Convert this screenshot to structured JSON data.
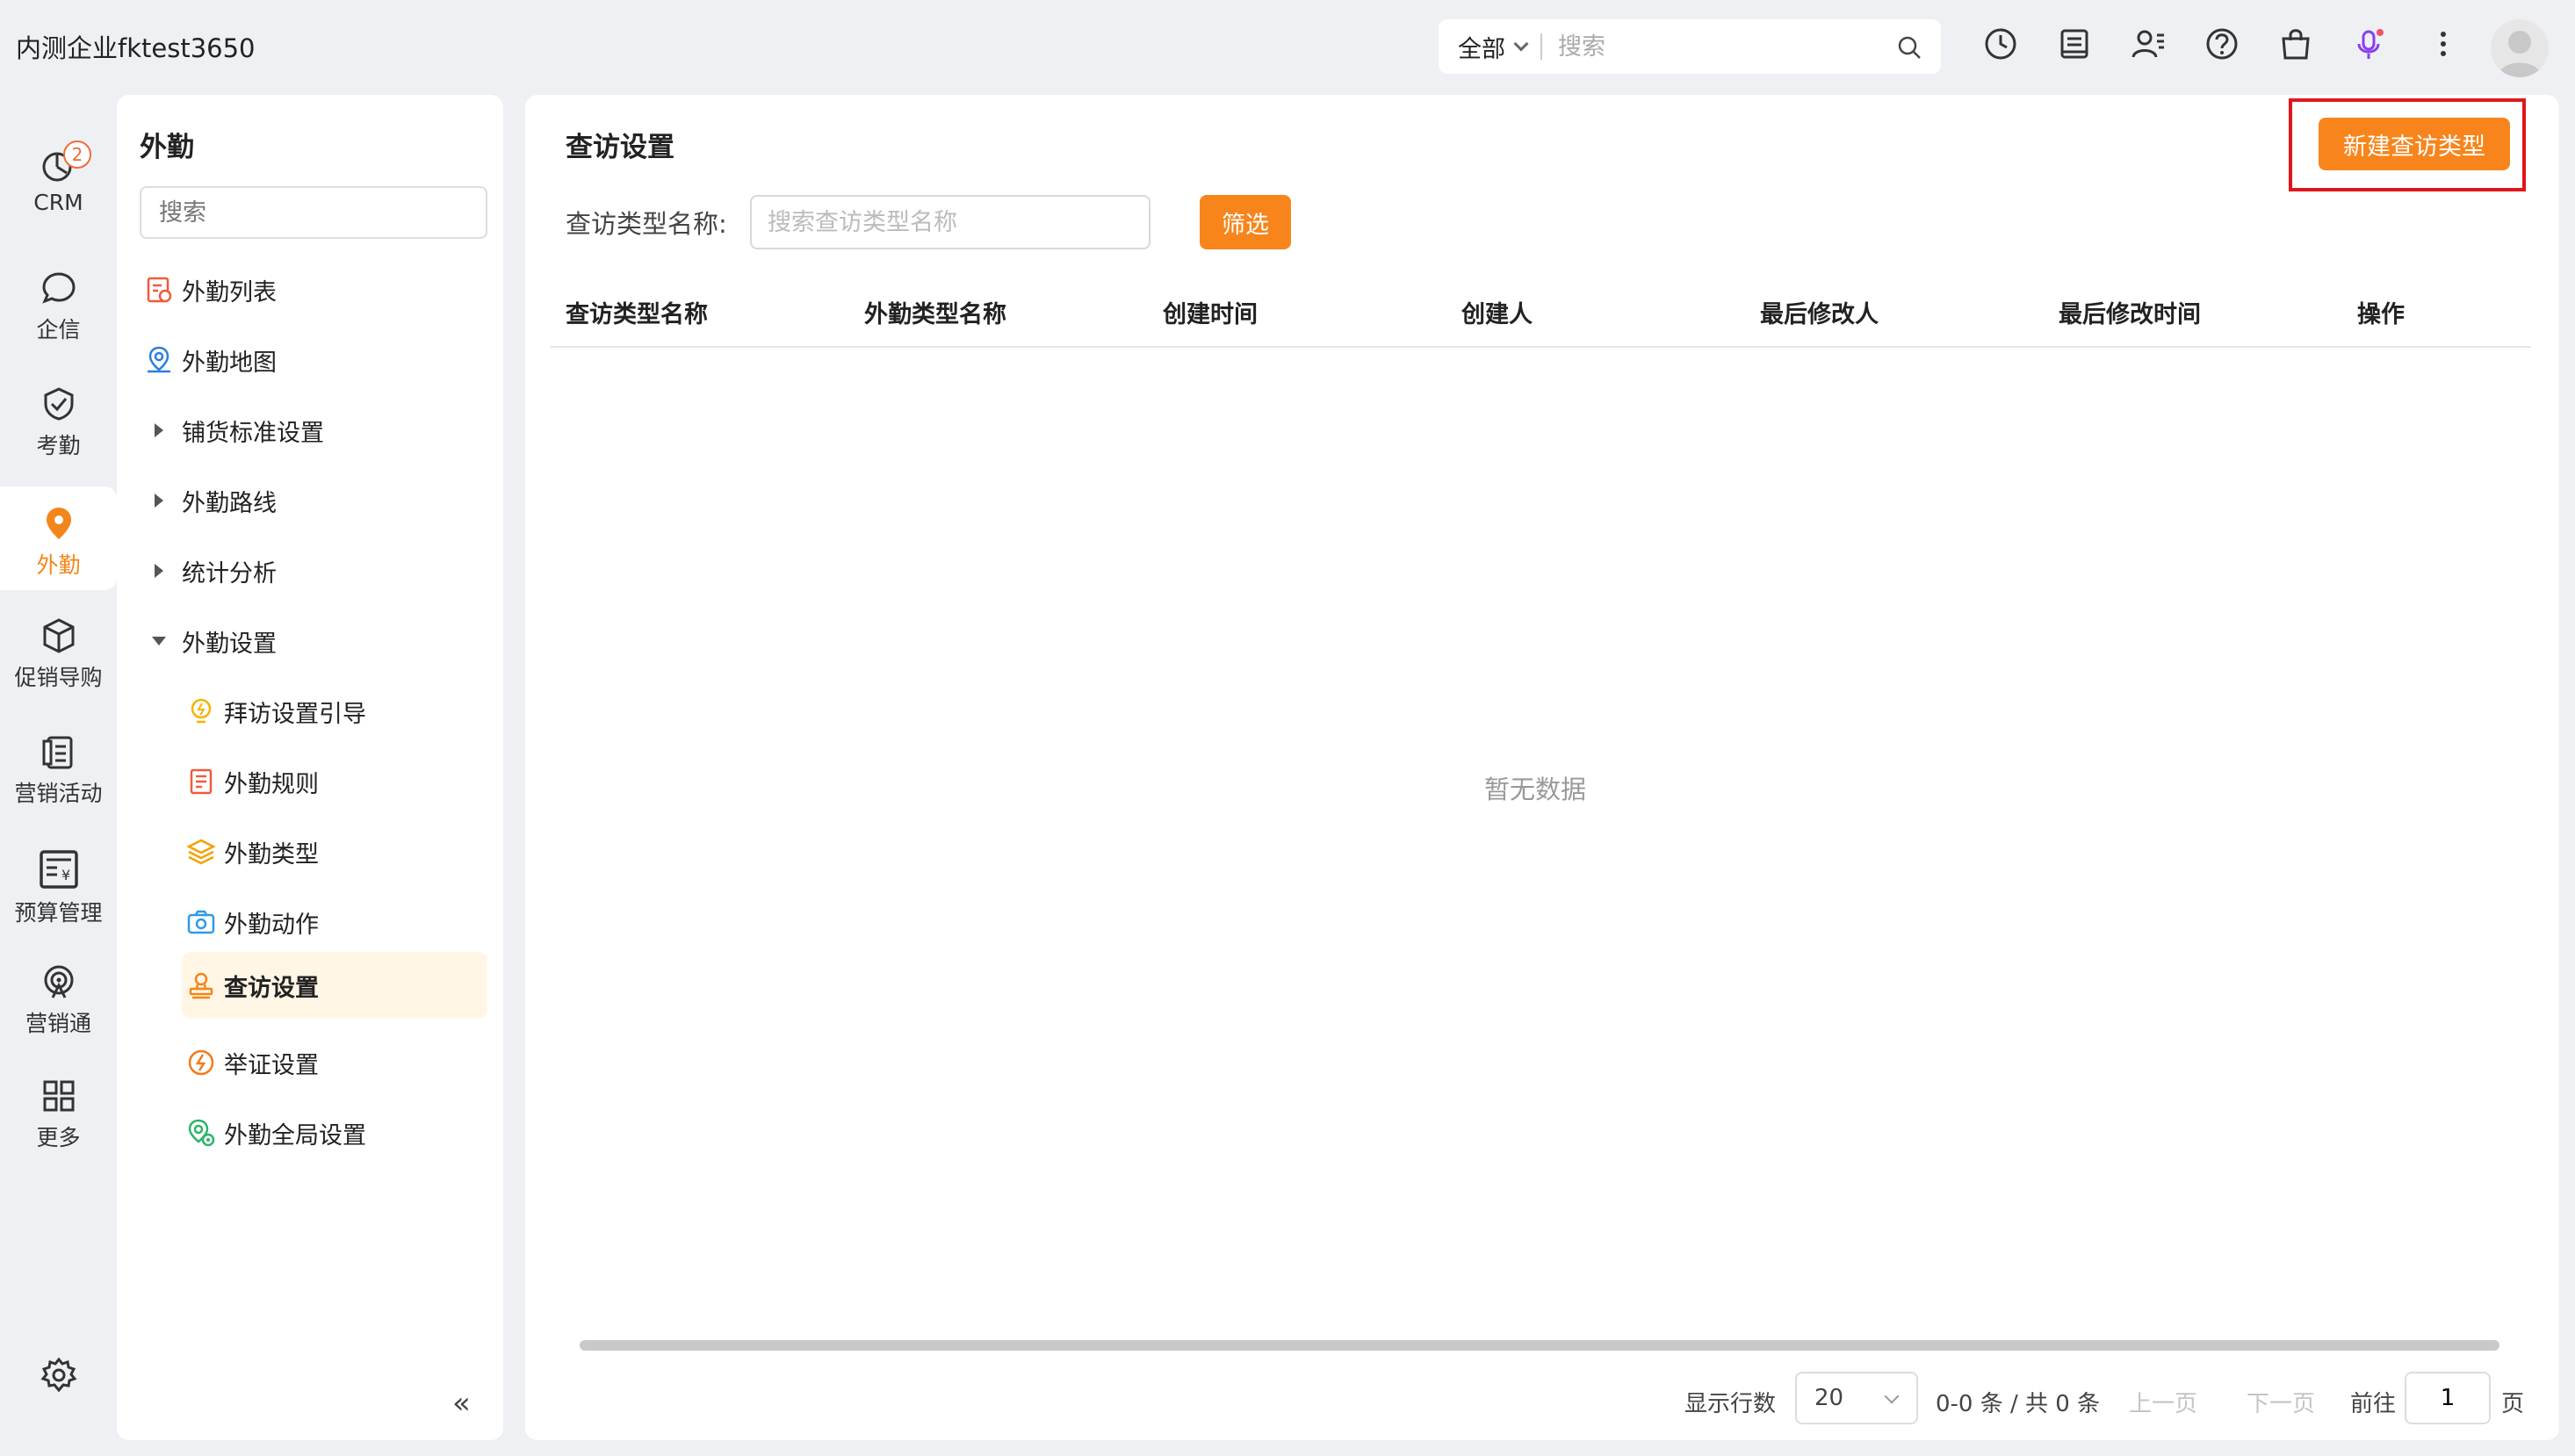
{
  "header": {
    "company": "内测企业fktest3650",
    "search_scope": "全部",
    "search_placeholder": "搜索"
  },
  "leftnav": {
    "items": [
      {
        "label": "CRM",
        "badge": "2"
      },
      {
        "label": "企信"
      },
      {
        "label": "考勤"
      },
      {
        "label": "外勤"
      },
      {
        "label": "促销导购"
      },
      {
        "label": "营销活动"
      },
      {
        "label": "预算管理"
      },
      {
        "label": "营销通"
      },
      {
        "label": "更多"
      }
    ]
  },
  "submenu": {
    "title": "外勤",
    "search_placeholder": "搜索",
    "items": [
      {
        "label": "外勤列表"
      },
      {
        "label": "外勤地图"
      },
      {
        "label": "铺货标准设置"
      },
      {
        "label": "外勤路线"
      },
      {
        "label": "统计分析"
      },
      {
        "label": "外勤设置"
      }
    ],
    "children": [
      {
        "label": "拜访设置引导"
      },
      {
        "label": "外勤规则"
      },
      {
        "label": "外勤类型"
      },
      {
        "label": "外勤动作"
      },
      {
        "label": "查访设置"
      },
      {
        "label": "举证设置"
      },
      {
        "label": "外勤全局设置"
      }
    ],
    "collapse": "«"
  },
  "main": {
    "title": "查访设置",
    "new_button": "新建查访类型",
    "filter_label": "查访类型名称:",
    "filter_placeholder": "搜索查访类型名称",
    "filter_button": "筛选",
    "columns": [
      "查访类型名称",
      "外勤类型名称",
      "创建时间",
      "创建人",
      "最后修改人",
      "最后修改时间",
      "操作"
    ],
    "empty_text": "暂无数据"
  },
  "pager": {
    "rows_label": "显示行数",
    "rows_value": "20",
    "summary": "0-0 条 / 共 0 条",
    "prev": "上一页",
    "next": "下一页",
    "goto": "前往",
    "page_value": "1",
    "page_unit": "页"
  },
  "colors": {
    "accent": "#f7851c",
    "highlight_frame": "#e0161b",
    "active_bg": "#fff6e6"
  }
}
